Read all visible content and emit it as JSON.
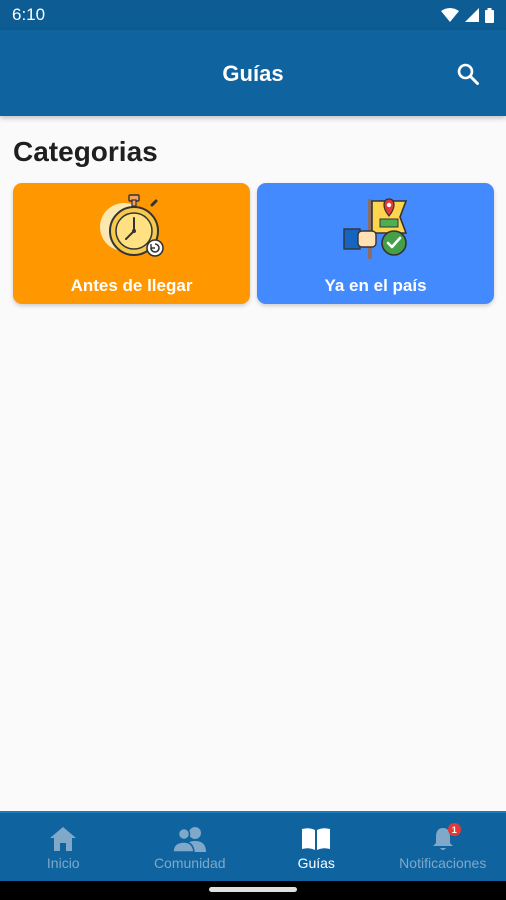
{
  "status_bar": {
    "time": "6:10"
  },
  "app_bar": {
    "title": "Guías",
    "search_icon": "search-icon"
  },
  "section": {
    "title": "Categorias"
  },
  "categories": [
    {
      "label": "Antes de llegar",
      "icon": "stopwatch-icon",
      "color": "#ff9800"
    },
    {
      "label": "Ya en el país",
      "icon": "flag-check-icon",
      "color": "#448aff"
    }
  ],
  "bottom_nav": {
    "items": [
      {
        "label": "Inicio",
        "icon": "home-icon",
        "active": false
      },
      {
        "label": "Comunidad",
        "icon": "people-icon",
        "active": false
      },
      {
        "label": "Guías",
        "icon": "book-icon",
        "active": true
      },
      {
        "label": "Notificaciones",
        "icon": "bell-icon",
        "active": false,
        "badge": "1"
      }
    ]
  },
  "colors": {
    "primary": "#0f64a0",
    "status_bar": "#0d5c94",
    "background": "#fafafa"
  }
}
